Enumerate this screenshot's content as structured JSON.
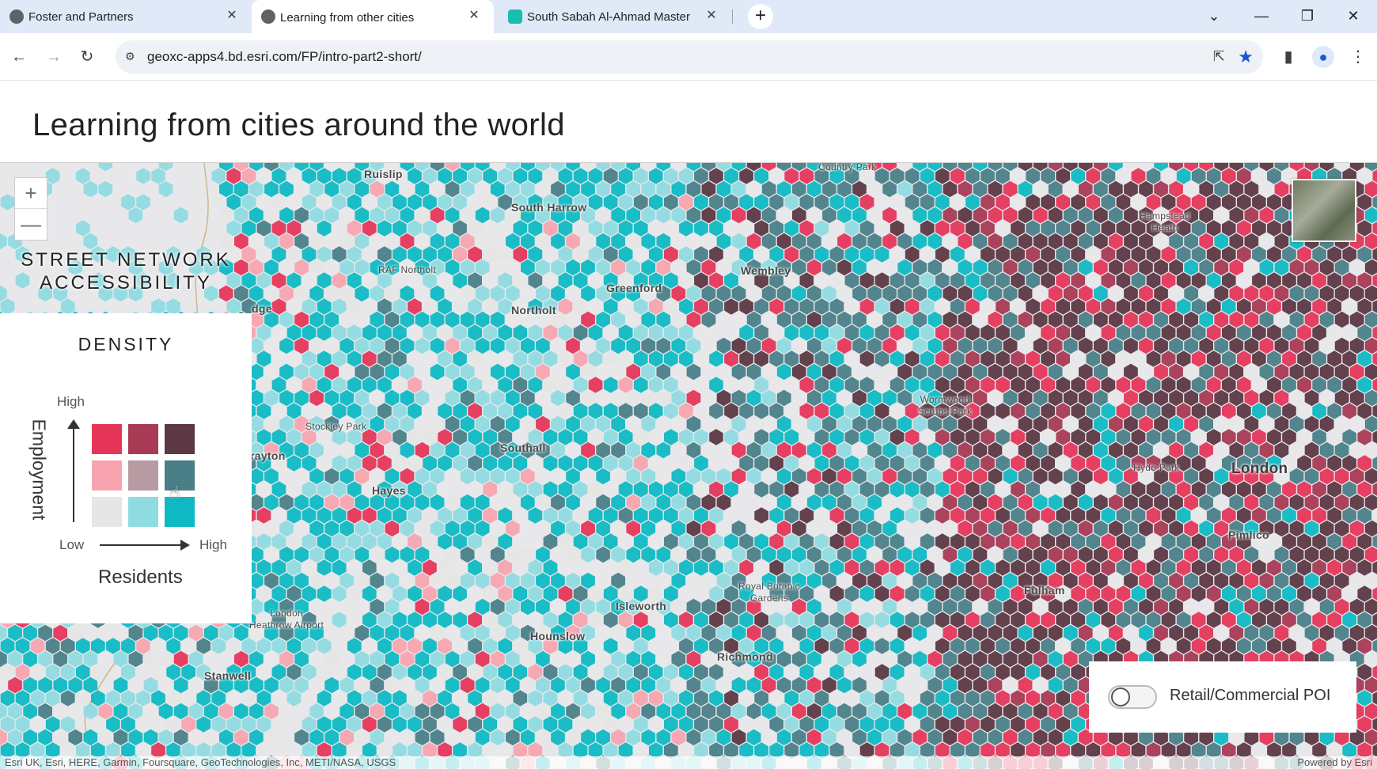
{
  "browser": {
    "tabs": [
      {
        "title": "Foster and Partners",
        "favicon": "globe-icon"
      },
      {
        "title": "Learning from other cities",
        "favicon": "globe-icon"
      },
      {
        "title": "South Sabah Al-Ahmad Master",
        "favicon": "app-icon"
      }
    ],
    "url": "geoxc-apps4.bd.esri.com/FP/intro-part2-short/",
    "icons": {
      "back": "←",
      "forward": "→",
      "reload": "↻",
      "close": "✕",
      "new_tab": "+",
      "share": "⇱",
      "star": "★",
      "minimize": "—",
      "restore": "❐",
      "tab_search": "⌄",
      "sidepanel": "▮",
      "profile": "●",
      "menu": "⋮",
      "site_info": "⚙"
    }
  },
  "page": {
    "title": "Learning from cities around the world"
  },
  "map": {
    "panel_title": "STREET NETWORK ACCESSIBILITY",
    "zoom_in": "+",
    "zoom_out": "—",
    "legend": {
      "title": "DENSITY",
      "y_high": "High",
      "y_label": "Employment",
      "x_low": "Low",
      "x_high": "High",
      "x_label": "Residents",
      "colors": [
        [
          "#e5365a",
          "#a83a55",
          "#5c3844"
        ],
        [
          "#f7a4b0",
          "#b89aa2",
          "#4a7f88"
        ],
        [
          "#e6e6e6",
          "#8fdbe2",
          "#0fb9c4"
        ]
      ]
    },
    "places": [
      {
        "name": "Ruislip",
        "cls": ""
      },
      {
        "name": "South Harrow",
        "cls": ""
      },
      {
        "name": "Country Park",
        "cls": "small"
      },
      {
        "name": "Hampstead Heath",
        "cls": "small"
      },
      {
        "name": "RAF Northolt",
        "cls": "small"
      },
      {
        "name": "Wembley",
        "cls": ""
      },
      {
        "name": "Greenford",
        "cls": ""
      },
      {
        "name": "Northolt",
        "cls": ""
      },
      {
        "name": "dge",
        "cls": ""
      },
      {
        "name": "Wormwood Scrubs Park",
        "cls": "small"
      },
      {
        "name": "Stockley Park",
        "cls": "small"
      },
      {
        "name": "Southall",
        "cls": ""
      },
      {
        "name": "rayton",
        "cls": ""
      },
      {
        "name": "Hyde Park",
        "cls": "small"
      },
      {
        "name": "London",
        "cls": "big"
      },
      {
        "name": "Hayes",
        "cls": ""
      },
      {
        "name": "Pimlico",
        "cls": ""
      },
      {
        "name": "Royal Botanic Gardens",
        "cls": "small"
      },
      {
        "name": "Fulham",
        "cls": ""
      },
      {
        "name": "Isleworth",
        "cls": ""
      },
      {
        "name": "London Heathrow Airport",
        "cls": "small"
      },
      {
        "name": "Hounslow",
        "cls": ""
      },
      {
        "name": "Richmond",
        "cls": ""
      },
      {
        "name": "Stanwell",
        "cls": ""
      }
    ],
    "toggle_label": "Retail/Commercial POI",
    "toggle_on": false,
    "attribution": "Esri UK, Esri, HERE, Garmin, Foursquare, GeoTechnologies, Inc, METI/NASA, USGS",
    "powered_by": "Powered by Esri"
  }
}
